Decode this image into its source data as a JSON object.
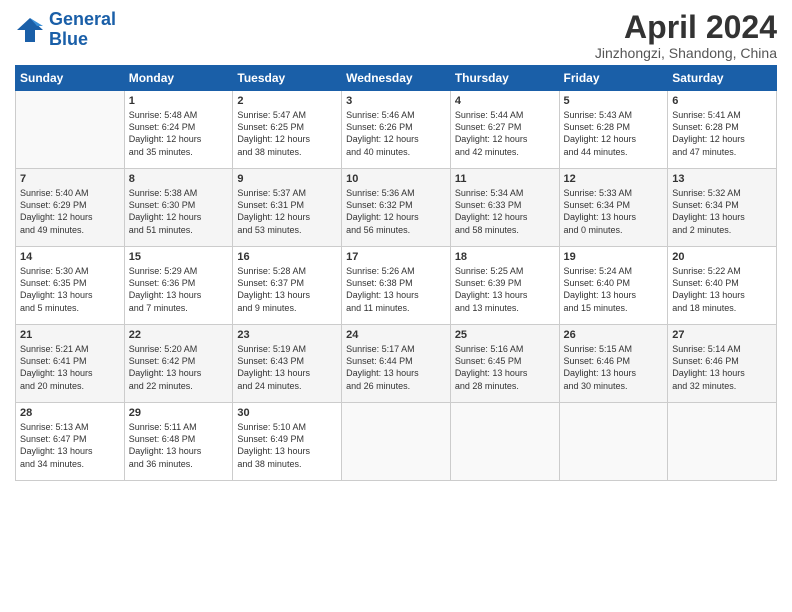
{
  "logo": {
    "line1": "General",
    "line2": "Blue"
  },
  "title": "April 2024",
  "location": "Jinzhongzi, Shandong, China",
  "days_of_week": [
    "Sunday",
    "Monday",
    "Tuesday",
    "Wednesday",
    "Thursday",
    "Friday",
    "Saturday"
  ],
  "weeks": [
    [
      {
        "num": "",
        "info": ""
      },
      {
        "num": "1",
        "info": "Sunrise: 5:48 AM\nSunset: 6:24 PM\nDaylight: 12 hours\nand 35 minutes."
      },
      {
        "num": "2",
        "info": "Sunrise: 5:47 AM\nSunset: 6:25 PM\nDaylight: 12 hours\nand 38 minutes."
      },
      {
        "num": "3",
        "info": "Sunrise: 5:46 AM\nSunset: 6:26 PM\nDaylight: 12 hours\nand 40 minutes."
      },
      {
        "num": "4",
        "info": "Sunrise: 5:44 AM\nSunset: 6:27 PM\nDaylight: 12 hours\nand 42 minutes."
      },
      {
        "num": "5",
        "info": "Sunrise: 5:43 AM\nSunset: 6:28 PM\nDaylight: 12 hours\nand 44 minutes."
      },
      {
        "num": "6",
        "info": "Sunrise: 5:41 AM\nSunset: 6:28 PM\nDaylight: 12 hours\nand 47 minutes."
      }
    ],
    [
      {
        "num": "7",
        "info": "Sunrise: 5:40 AM\nSunset: 6:29 PM\nDaylight: 12 hours\nand 49 minutes."
      },
      {
        "num": "8",
        "info": "Sunrise: 5:38 AM\nSunset: 6:30 PM\nDaylight: 12 hours\nand 51 minutes."
      },
      {
        "num": "9",
        "info": "Sunrise: 5:37 AM\nSunset: 6:31 PM\nDaylight: 12 hours\nand 53 minutes."
      },
      {
        "num": "10",
        "info": "Sunrise: 5:36 AM\nSunset: 6:32 PM\nDaylight: 12 hours\nand 56 minutes."
      },
      {
        "num": "11",
        "info": "Sunrise: 5:34 AM\nSunset: 6:33 PM\nDaylight: 12 hours\nand 58 minutes."
      },
      {
        "num": "12",
        "info": "Sunrise: 5:33 AM\nSunset: 6:34 PM\nDaylight: 13 hours\nand 0 minutes."
      },
      {
        "num": "13",
        "info": "Sunrise: 5:32 AM\nSunset: 6:34 PM\nDaylight: 13 hours\nand 2 minutes."
      }
    ],
    [
      {
        "num": "14",
        "info": "Sunrise: 5:30 AM\nSunset: 6:35 PM\nDaylight: 13 hours\nand 5 minutes."
      },
      {
        "num": "15",
        "info": "Sunrise: 5:29 AM\nSunset: 6:36 PM\nDaylight: 13 hours\nand 7 minutes."
      },
      {
        "num": "16",
        "info": "Sunrise: 5:28 AM\nSunset: 6:37 PM\nDaylight: 13 hours\nand 9 minutes."
      },
      {
        "num": "17",
        "info": "Sunrise: 5:26 AM\nSunset: 6:38 PM\nDaylight: 13 hours\nand 11 minutes."
      },
      {
        "num": "18",
        "info": "Sunrise: 5:25 AM\nSunset: 6:39 PM\nDaylight: 13 hours\nand 13 minutes."
      },
      {
        "num": "19",
        "info": "Sunrise: 5:24 AM\nSunset: 6:40 PM\nDaylight: 13 hours\nand 15 minutes."
      },
      {
        "num": "20",
        "info": "Sunrise: 5:22 AM\nSunset: 6:40 PM\nDaylight: 13 hours\nand 18 minutes."
      }
    ],
    [
      {
        "num": "21",
        "info": "Sunrise: 5:21 AM\nSunset: 6:41 PM\nDaylight: 13 hours\nand 20 minutes."
      },
      {
        "num": "22",
        "info": "Sunrise: 5:20 AM\nSunset: 6:42 PM\nDaylight: 13 hours\nand 22 minutes."
      },
      {
        "num": "23",
        "info": "Sunrise: 5:19 AM\nSunset: 6:43 PM\nDaylight: 13 hours\nand 24 minutes."
      },
      {
        "num": "24",
        "info": "Sunrise: 5:17 AM\nSunset: 6:44 PM\nDaylight: 13 hours\nand 26 minutes."
      },
      {
        "num": "25",
        "info": "Sunrise: 5:16 AM\nSunset: 6:45 PM\nDaylight: 13 hours\nand 28 minutes."
      },
      {
        "num": "26",
        "info": "Sunrise: 5:15 AM\nSunset: 6:46 PM\nDaylight: 13 hours\nand 30 minutes."
      },
      {
        "num": "27",
        "info": "Sunrise: 5:14 AM\nSunset: 6:46 PM\nDaylight: 13 hours\nand 32 minutes."
      }
    ],
    [
      {
        "num": "28",
        "info": "Sunrise: 5:13 AM\nSunset: 6:47 PM\nDaylight: 13 hours\nand 34 minutes."
      },
      {
        "num": "29",
        "info": "Sunrise: 5:11 AM\nSunset: 6:48 PM\nDaylight: 13 hours\nand 36 minutes."
      },
      {
        "num": "30",
        "info": "Sunrise: 5:10 AM\nSunset: 6:49 PM\nDaylight: 13 hours\nand 38 minutes."
      },
      {
        "num": "",
        "info": ""
      },
      {
        "num": "",
        "info": ""
      },
      {
        "num": "",
        "info": ""
      },
      {
        "num": "",
        "info": ""
      }
    ]
  ]
}
